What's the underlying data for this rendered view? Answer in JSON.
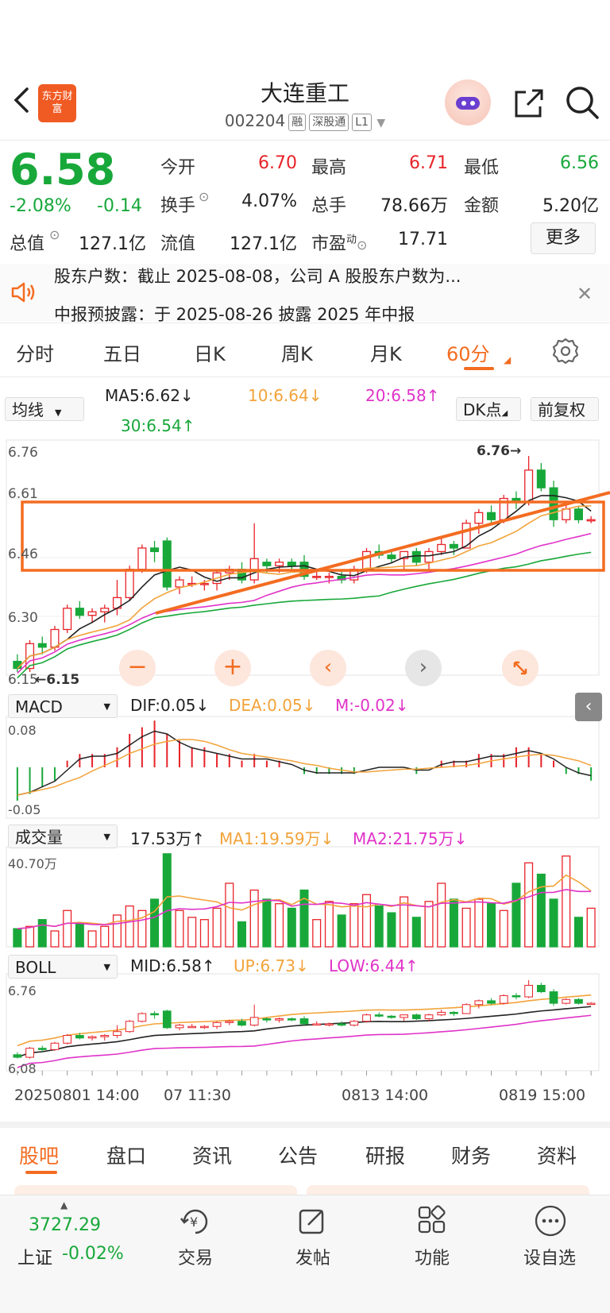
{
  "header": {
    "title": "大连重工",
    "code": "002204",
    "tags": [
      "融",
      "深股通",
      "L1"
    ],
    "logo_text": "东方财富"
  },
  "quote": {
    "price": "6.58",
    "change_pct": "-2.08%",
    "change": "-0.14",
    "open_label": "今开",
    "open": "6.70",
    "high_label": "最高",
    "high": "6.71",
    "low_label": "最低",
    "low": "6.56",
    "turnover_label": "换手",
    "turnover": "4.07%",
    "volume_label": "总手",
    "volume": "78.66万",
    "amount_label": "金额",
    "amount": "5.20亿",
    "mktcap_label": "总值",
    "mktcap": "127.1亿",
    "float_label": "流值",
    "float": "127.1亿",
    "pe_label": "市盈",
    "pe_sup": "动",
    "pe": "17.71",
    "more_label": "更多"
  },
  "news": {
    "line1": "股东户数：截止 2025-08-08，公司 A 股股东户数为...",
    "line2": "中报预披露：于 2025-08-26 披露 2025 年中报"
  },
  "period_tabs": [
    "分时",
    "五日",
    "日K",
    "周K",
    "月K",
    "60分"
  ],
  "active_period": "60分",
  "ma_bar": {
    "selector": "均线",
    "ma5": "MA5:6.62↓",
    "ma10": "10:6.64↓",
    "ma20": "20:6.58↑",
    "ma30": "30:6.54↑",
    "dk": "DK点",
    "fq": "前复权"
  },
  "main_chart": {
    "y_labels": [
      "6.76",
      "6.61",
      "6.46",
      "6.30",
      "6.15"
    ],
    "high_note": "6.76→",
    "low_note": "←6.15"
  },
  "macd_bar": {
    "selector": "MACD",
    "dif": "DIF:0.05↓",
    "dea": "DEA:0.05↓",
    "m": "M:-0.02↓",
    "y_top": "0.08",
    "y_bottom": "-0.05"
  },
  "vol_bar": {
    "selector": "成交量",
    "vol": "17.53万↑",
    "ma1": "MA1:19.59万↓",
    "ma2": "MA2:21.75万↓",
    "y_top": "40.70万"
  },
  "boll_bar": {
    "selector": "BOLL",
    "mid": "MID:6.58↑",
    "up": "UP:6.73↓",
    "low": "LOW:6.44↑",
    "y_top": "6.76",
    "y_bottom": "6.08"
  },
  "x_axis": {
    "labels": [
      "20250801 14:00",
      "07 11:30",
      "0813 14:00",
      "0819 15:00"
    ]
  },
  "bottom_tabs": [
    "股吧",
    "盘口",
    "资讯",
    "公告",
    "研报",
    "财务",
    "资料"
  ],
  "active_bottom_tab": "股吧",
  "nav": {
    "index_value": "3727.29",
    "index_name": "上证",
    "index_change": "-0.02%",
    "items": [
      "交易",
      "发帖",
      "功能",
      "设自选"
    ]
  },
  "colors": {
    "up": "#e8232a",
    "down": "#18a83a",
    "accent": "#f36c21",
    "ma10": "#f2a33a",
    "ma20": "#e033c8"
  },
  "chart_data": {
    "type": "candlestick",
    "y_range": [
      6.15,
      6.76
    ],
    "ohlc": [
      [
        6.18,
        6.2,
        6.15,
        6.16
      ],
      [
        6.16,
        6.24,
        6.15,
        6.23
      ],
      [
        6.23,
        6.25,
        6.2,
        6.22
      ],
      [
        6.22,
        6.28,
        6.21,
        6.27
      ],
      [
        6.27,
        6.34,
        6.26,
        6.33
      ],
      [
        6.33,
        6.35,
        6.3,
        6.31
      ],
      [
        6.31,
        6.33,
        6.29,
        6.32
      ],
      [
        6.32,
        6.34,
        6.29,
        6.33
      ],
      [
        6.33,
        6.41,
        6.31,
        6.36
      ],
      [
        6.36,
        6.45,
        6.35,
        6.44
      ],
      [
        6.44,
        6.51,
        6.43,
        6.5
      ],
      [
        6.5,
        6.52,
        6.46,
        6.49
      ],
      [
        6.52,
        6.53,
        6.38,
        6.39
      ],
      [
        6.39,
        6.42,
        6.37,
        6.41
      ],
      [
        6.4,
        6.42,
        6.39,
        6.4
      ],
      [
        6.4,
        6.41,
        6.38,
        6.4
      ],
      [
        6.4,
        6.44,
        6.38,
        6.43
      ],
      [
        6.43,
        6.45,
        6.41,
        6.44
      ],
      [
        6.44,
        6.46,
        6.4,
        6.41
      ],
      [
        6.41,
        6.57,
        6.4,
        6.47
      ],
      [
        6.46,
        6.47,
        6.43,
        6.45
      ],
      [
        6.45,
        6.47,
        6.43,
        6.46
      ],
      [
        6.46,
        6.47,
        6.44,
        6.45
      ],
      [
        6.46,
        6.48,
        6.41,
        6.42
      ],
      [
        6.42,
        6.44,
        6.41,
        6.42
      ],
      [
        6.42,
        6.43,
        6.4,
        6.42
      ],
      [
        6.42,
        6.44,
        6.4,
        6.41
      ],
      [
        6.41,
        6.45,
        6.4,
        6.44
      ],
      [
        6.44,
        6.5,
        6.43,
        6.49
      ],
      [
        6.49,
        6.51,
        6.47,
        6.48
      ],
      [
        6.48,
        6.49,
        6.46,
        6.47
      ],
      [
        6.47,
        6.49,
        6.44,
        6.49
      ],
      [
        6.49,
        6.5,
        6.45,
        6.46
      ],
      [
        6.46,
        6.5,
        6.44,
        6.49
      ],
      [
        6.49,
        6.53,
        6.48,
        6.51
      ],
      [
        6.51,
        6.52,
        6.48,
        6.5
      ],
      [
        6.5,
        6.58,
        6.5,
        6.57
      ],
      [
        6.57,
        6.61,
        6.54,
        6.6
      ],
      [
        6.6,
        6.62,
        6.57,
        6.58
      ],
      [
        6.58,
        6.65,
        6.57,
        6.64
      ],
      [
        6.64,
        6.66,
        6.61,
        6.63
      ],
      [
        6.63,
        6.76,
        6.62,
        6.72
      ],
      [
        6.72,
        6.74,
        6.66,
        6.67
      ],
      [
        6.67,
        6.69,
        6.56,
        6.58
      ],
      [
        6.58,
        6.62,
        6.57,
        6.61
      ],
      [
        6.61,
        6.62,
        6.57,
        6.58
      ],
      [
        6.58,
        6.59,
        6.57,
        6.58
      ]
    ],
    "volume": [
      8,
      9,
      12,
      7,
      16,
      10,
      7,
      9,
      14,
      18,
      16,
      21,
      41,
      16,
      13,
      12,
      17,
      28,
      11,
      25,
      21,
      19,
      17,
      25,
      12,
      20,
      14,
      19,
      23,
      18,
      15,
      22,
      13,
      20,
      28,
      21,
      17,
      21,
      19,
      16,
      28,
      37,
      32,
      21,
      40,
      13,
      17
    ],
    "macd": [
      -0.05,
      -0.04,
      -0.03,
      -0.02,
      0.01,
      0.02,
      0.02,
      0.02,
      0.03,
      0.05,
      0.06,
      0.07,
      0.05,
      0.04,
      0.03,
      0.03,
      0.02,
      0.02,
      0.01,
      0.02,
      0.01,
      0.01,
      0.0,
      -0.01,
      -0.01,
      -0.01,
      -0.01,
      -0.01,
      0.0,
      0.0,
      0.0,
      0.0,
      -0.01,
      0.0,
      0.01,
      0.01,
      0.01,
      0.02,
      0.02,
      0.02,
      0.03,
      0.03,
      0.02,
      0.01,
      -0.01,
      -0.01,
      -0.02
    ]
  }
}
